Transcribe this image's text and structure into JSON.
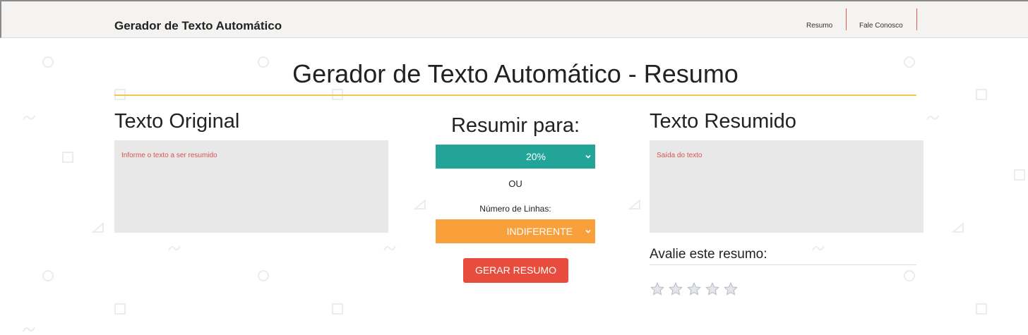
{
  "navbar": {
    "brand": "Gerador de Texto Automático",
    "links": [
      "Resumo",
      "Fale Conosco"
    ]
  },
  "page_title": "Gerador de Texto Automático - Resumo",
  "left": {
    "heading": "Texto Original",
    "placeholder": "Informe o texto a ser resumido"
  },
  "middle": {
    "heading": "Resumir para:",
    "percent_value": "20%",
    "or_label": "OU",
    "lines_label": "Número de Linhas:",
    "lines_value": "INDIFERENTE",
    "generate_label": "GERAR RESUMO"
  },
  "right": {
    "heading": "Texto Resumido",
    "placeholder": "Saída do texto"
  },
  "rating": {
    "heading": "Avalie este resumo:",
    "max_stars": 5,
    "selected": 0
  },
  "colors": {
    "teal": "#22a598",
    "orange": "#f9a03a",
    "red": "#e74c3c",
    "title_rule": "#f2c94c",
    "placeholder_text": "#d9534f"
  },
  "icons": [
    "chevron-down-icon",
    "star-icon"
  ]
}
